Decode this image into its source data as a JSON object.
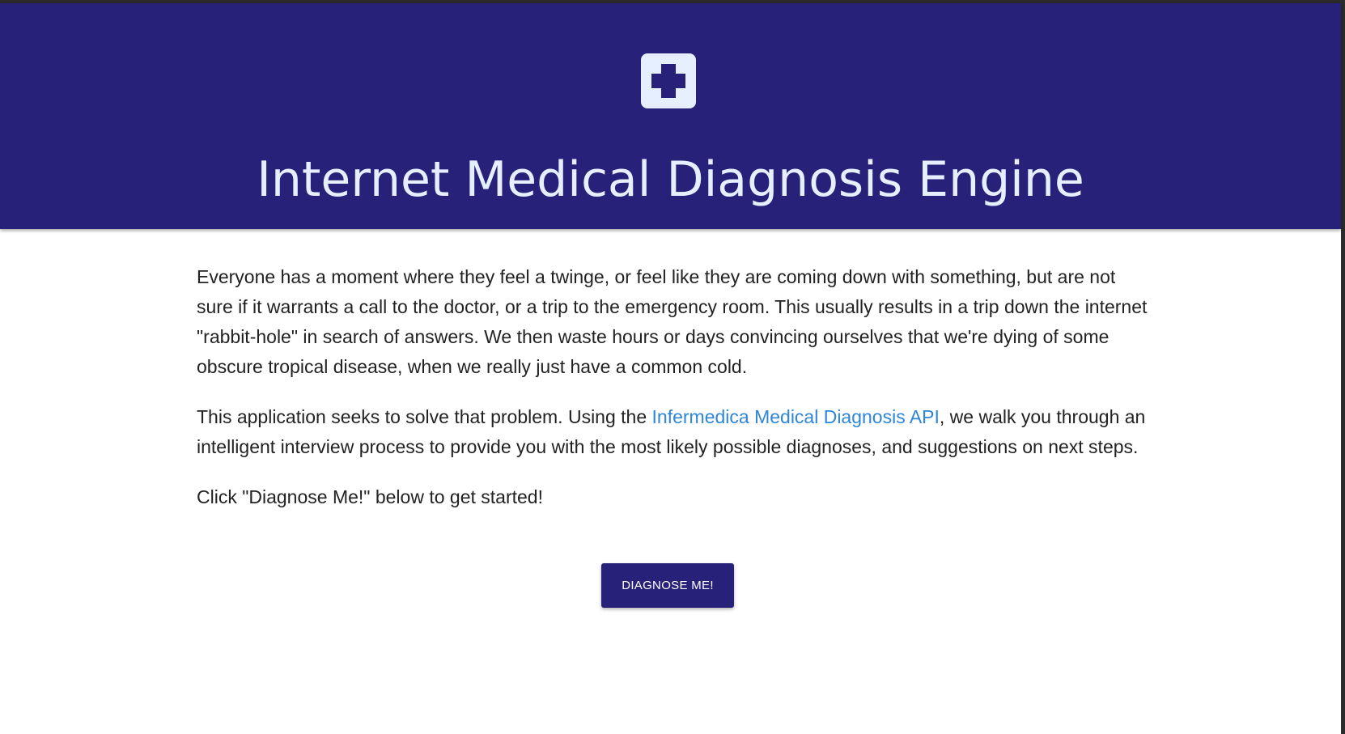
{
  "header": {
    "logo_icon": "medical-cross-icon",
    "title": "Internet Medical Diagnosis Engine",
    "background_color": "#28217a",
    "text_color": "#e6efff"
  },
  "intro": {
    "paragraph1": "Everyone has a moment where they feel a twinge, or feel like they are coming down with something, but are not sure if it warrants a call to the doctor, or a trip to the emergency room. This usually results in a trip down the internet \"rabbit-hole\" in search of answers. We then waste hours or days convincing ourselves that we're dying of some obscure tropical disease, when we really just have a common cold.",
    "paragraph2_before": "This application seeks to solve that problem. Using the ",
    "paragraph2_link": "Infermedica Medical Diagnosis API",
    "paragraph2_after": ", we walk you through an intelligent interview process to provide you with the most likely possible diagnoses, and suggestions on next steps.",
    "paragraph3": "Click \"Diagnose Me!\" below to get started!",
    "link_color": "#2e86d8"
  },
  "actions": {
    "diagnose_label": "DIAGNOSE ME!",
    "button_color": "#28217a"
  }
}
